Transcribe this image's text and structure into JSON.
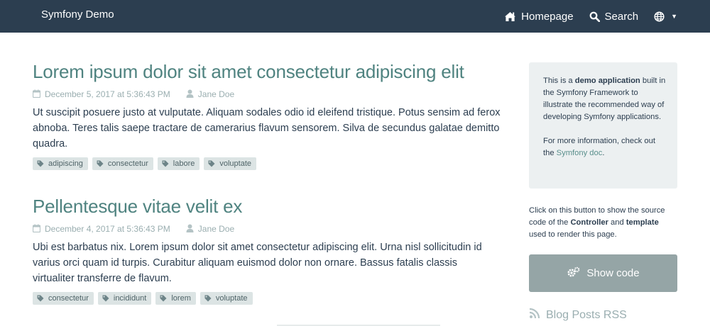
{
  "navbar": {
    "brand": "Symfony Demo",
    "homepage_label": "Homepage",
    "search_label": "Search",
    "home_icon": "home-icon",
    "search_icon": "search-icon",
    "language_icon": "globe-icon"
  },
  "posts": [
    {
      "title": "Lorem ipsum dolor sit amet consectetur adipiscing elit",
      "date": "December 5, 2017 at 5:36:43 PM",
      "author": "Jane Doe",
      "summary": "Ut suscipit posuere justo at vulputate. Aliquam sodales odio id eleifend tristique. Potus sensim ad ferox abnoba. Teres talis saepe tractare de camerarius flavum sensorem. Silva de secundus galatae demitto quadra.",
      "tags": [
        "adipiscing",
        "consectetur",
        "labore",
        "voluptate"
      ]
    },
    {
      "title": "Pellentesque vitae velit ex",
      "date": "December 4, 2017 at 5:36:43 PM",
      "author": "Jane Doe",
      "summary": "Ubi est barbatus nix. Lorem ipsum dolor sit amet consectetur adipiscing elit. Urna nisl sollicitudin id varius orci quam id turpis. Curabitur aliquam euismod dolor non ornare. Bassus fatalis classis virtualiter transferre de flavum.",
      "tags": [
        "consectetur",
        "incididunt",
        "lorem",
        "voluptate"
      ]
    }
  ],
  "sidebar": {
    "about_prefix": "This is a ",
    "about_bold": "demo application",
    "about_suffix": " built in the Symfony Framework to illustrate the recommended way of developing Symfony applications.",
    "more_prefix": "For more information, check out the ",
    "more_link": "Symfony doc",
    "more_suffix": ".",
    "hint_prefix": "Click on this button to show the source code of the ",
    "hint_controller": "Controller",
    "hint_and": " and ",
    "hint_template": "template",
    "hint_suffix": " used to render this page.",
    "show_code_label": "Show code",
    "rss_label": "Blog Posts RSS"
  },
  "colors": {
    "navbar_bg": "#2c3e50",
    "title_link": "#4f8380",
    "button_bg": "#95a5a6",
    "about_bg": "#ecf0f1"
  }
}
